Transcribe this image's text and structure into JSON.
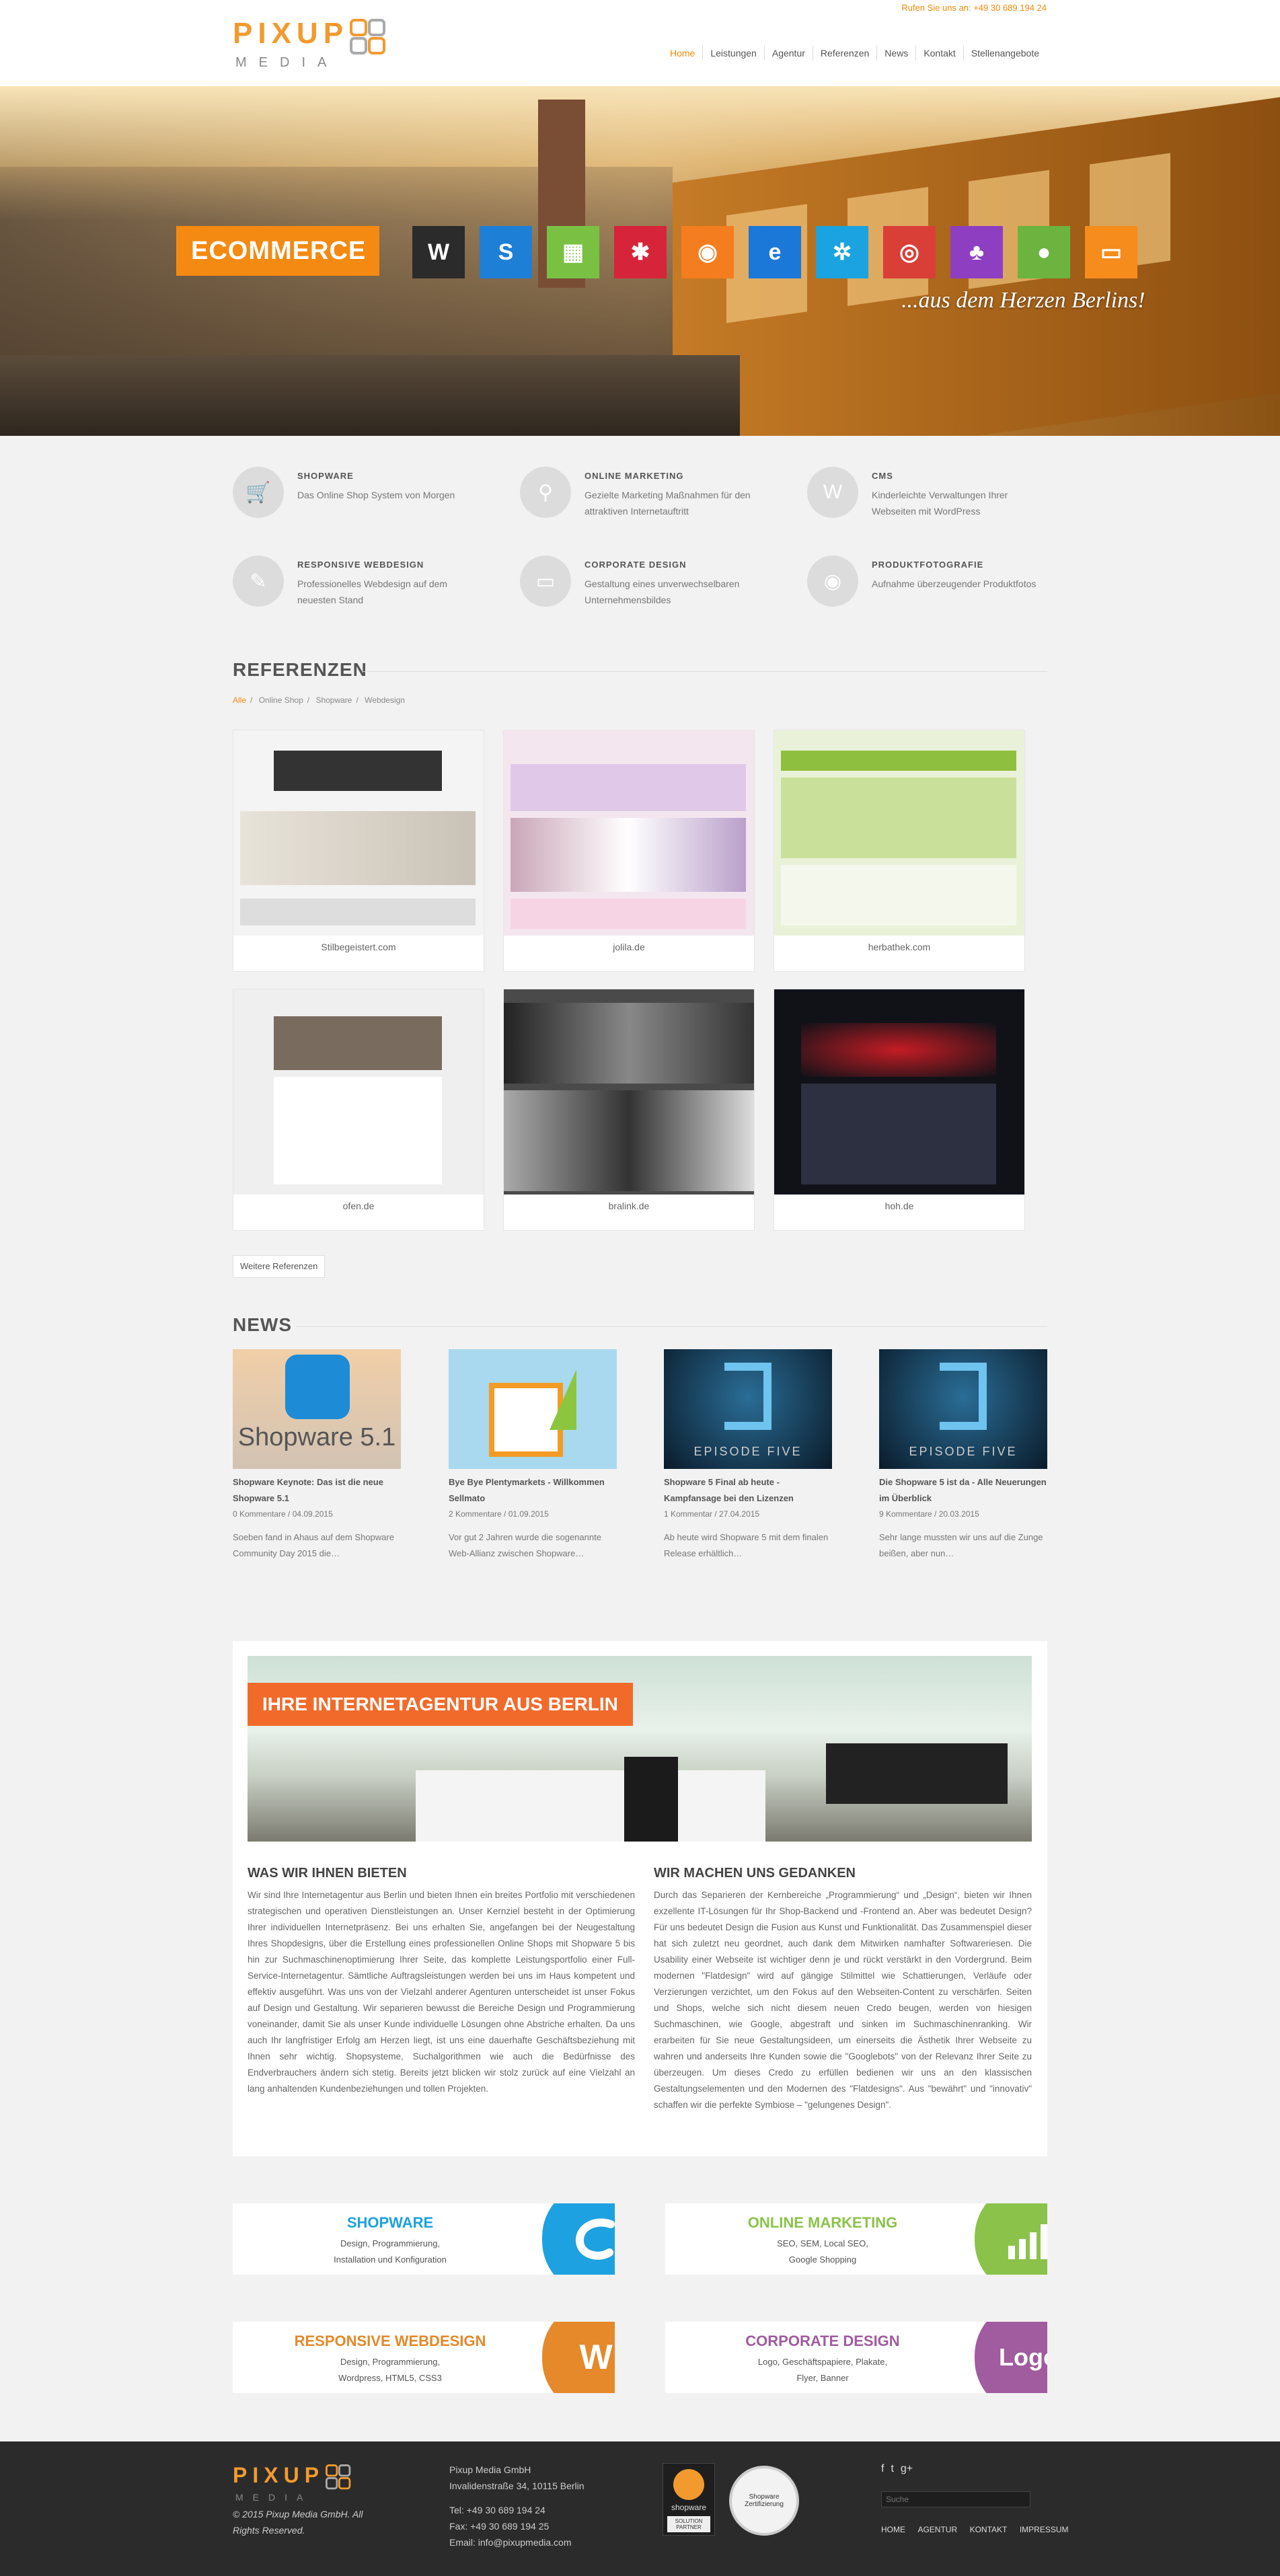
{
  "header": {
    "phone": "Rufen Sie uns an: +49 30 689 194 24",
    "logo_text": "PIXUP",
    "logo_sub": "MEDIA",
    "nav": [
      "Home",
      "Leistungen",
      "Agentur",
      "Referenzen",
      "News",
      "Kontakt",
      "Stellenangebote"
    ]
  },
  "hero": {
    "badge": "ECOMMERCE",
    "tiles": [
      {
        "icon": "wordpress-icon",
        "color": "#2b2b2b"
      },
      {
        "icon": "shopware-icon",
        "color": "#1e7fd6"
      },
      {
        "icon": "grid-icon",
        "color": "#7ac143"
      },
      {
        "icon": "joomla-icon",
        "color": "#d6243a"
      },
      {
        "icon": "firefox-icon",
        "color": "#f47d1f"
      },
      {
        "icon": "internet-explorer-icon",
        "color": "#1b78d8"
      },
      {
        "icon": "safari-icon",
        "color": "#1aa3e0"
      },
      {
        "icon": "chrome-icon",
        "color": "#d93f36"
      },
      {
        "icon": "android-icon",
        "color": "#8e3fc1"
      },
      {
        "icon": "apple-icon",
        "color": "#6cb33f"
      },
      {
        "icon": "message-icon",
        "color": "#f58c1c"
      }
    ],
    "slogan": "...aus dem Herzen Berlins!"
  },
  "services": [
    {
      "icon": "cart-icon",
      "title": "SHOPWARE",
      "desc": "Das Online Shop System von Morgen"
    },
    {
      "icon": "search-icon",
      "title": "ONLINE MARKETING",
      "desc": "Gezielte Marketing Maßnahmen für den attraktiven Internetauftritt"
    },
    {
      "icon": "wordpress-icon",
      "title": "CMS",
      "desc": "Kinderleichte Verwaltungen Ihrer Webseiten mit WordPress"
    },
    {
      "icon": "pencil-icon",
      "title": "RESPONSIVE WEBDESIGN",
      "desc": "Professionelles Webdesign auf dem neuesten Stand"
    },
    {
      "icon": "monitor-icon",
      "title": "CORPORATE DESIGN",
      "desc": "Gestaltung eines unverwechselbaren Unternehmensbildes"
    },
    {
      "icon": "camera-icon",
      "title": "PRODUKTFOTOGRAFIE",
      "desc": "Aufnahme überzeugender Produktfotos"
    }
  ],
  "references": {
    "title": "REFERENZEN",
    "filters": [
      "Alle",
      "Online Shop",
      "Shopware",
      "Webdesign"
    ],
    "items": [
      {
        "label": "Stilbegeistert.com",
        "bg": "#f4f4f4"
      },
      {
        "label": "jolila.de",
        "bg": "#f3e6ef"
      },
      {
        "label": "herbathek.com",
        "bg": "#e9f2d8"
      },
      {
        "label": "ofen.de",
        "bg": "#efefef"
      },
      {
        "label": "bralink.de",
        "bg": "#4a4a4a"
      },
      {
        "label": "hoh.de",
        "bg": "#101218"
      }
    ],
    "more_button": "Weitere Referenzen"
  },
  "news": {
    "title": "NEWS",
    "items": [
      {
        "title": "Shopware Keynote: Das ist die neue Shopware 5.1",
        "meta": "0 Kommentare / 04.09.2015",
        "excerpt": "Soeben fand in Ahaus auf dem Shopware Community Day 2015 die…",
        "image_text": "Shopware 5.1"
      },
      {
        "title": "Bye Bye Plentymarkets - Willkommen Sellmato",
        "meta": "2 Kommentare / 01.09.2015",
        "excerpt": "Vor gut 2 Jahren wurde die sogenannte Web-Allianz zwischen Shopware…",
        "image_text": ""
      },
      {
        "title": "Shopware 5 Final ab heute - Kampfansage bei den Lizenzen",
        "meta": "1 Kommentar / 27.04.2015",
        "excerpt": "Ab heute wird Shopware 5 mit dem finalen Release erhältlich…",
        "image_text": "EPISODE FIVE"
      },
      {
        "title": "Die Shopware 5 ist da - Alle Neuerungen im Überblick",
        "meta": "9 Kommentare / 20.03.2015",
        "excerpt": "Sehr lange mussten wir uns auf die Zunge beißen, aber nun…",
        "image_text": "EPISODE FIVE"
      }
    ]
  },
  "agency": {
    "banner": "IHRE INTERNETAGENTUR AUS BERLIN",
    "left_title": "WAS WIR IHNEN BIETEN",
    "left_text": "Wir sind Ihre Internetagentur aus Berlin und bieten Ihnen ein breites Portfolio mit verschiedenen strategischen und operativen Dienstleistungen an. Unser Kernziel besteht in der Optimierung Ihrer individuellen Internetpräsenz. Bei uns erhalten Sie, angefangen bei der Neugestaltung Ihres Shopdesigns, über die Erstellung eines professionellen Online Shops mit Shopware 5 bis hin zur Suchmaschinenoptimierung Ihrer Seite, das komplette Leistungsportfolio einer Full-Service-Internetagentur. Sämtliche Auftragsleistungen werden bei uns im Haus kompetent und effektiv ausgeführt. Was uns von der Vielzahl anderer Agenturen unterscheidet ist unser Fokus auf Design und Gestaltung. Wir separieren bewusst die Bereiche Design und Programmierung voneinander, damit Sie als unser Kunde individuelle Lösungen ohne Abstriche erhalten. Da uns auch Ihr langfristiger Erfolg am Herzen liegt, ist uns eine dauerhafte Geschäftsbeziehung mit Ihnen sehr wichtig. Shopsysteme, Suchalgorithmen wie auch die Bedürfnisse des Endverbrauchers ändern sich stetig. Bereits jetzt blicken wir stolz zurück auf eine Vielzahl an lang anhaltenden Kundenbeziehungen und tollen Projekten.",
    "right_title": "WIR MACHEN UNS GEDANKEN",
    "right_text": "Durch das Separieren der Kernbereiche „Programmierung“ und „Design“, bieten wir Ihnen exzellente IT-Lösungen für Ihr Shop-Backend und -Frontend an. Aber was bedeutet Design? Für uns bedeutet Design die Fusion aus Kunst und Funktionalität. Das Zusammenspiel dieser hat sich zuletzt neu geordnet, auch dank dem Mitwirken namhafter Softwareriesen. Die Usability einer Webseite ist wichtiger denn je und rückt verstärkt in den Vordergrund. Beim modernen \"Flatdesign\" wird auf gängige Stilmittel wie Schattierungen, Verläufe oder Verzierungen verzichtet, um den Fokus auf den Webseiten-Content zu verschärfen. Seiten und Shops, welche sich nicht diesem neuen Credo beugen, werden von hiesigen Suchmaschinen, wie Google, abgestraft und sinken im Suchmaschinenranking. Wir erarbeiten für Sie neue Gestaltungsideen, um einerseits die Ästhetik Ihrer Webseite zu wahren und anderseits Ihre Kunden sowie die \"Googlebots\" von der Relevanz Ihrer Seite zu überzeugen. Um dieses Credo zu erfüllen bedienen wir uns an den klassischen Gestaltungselementen und den Modernen des \"Flatdesigns\". Aus \"bewährt\" und \"innovativ\" schaffen wir die perfekte Symbiose – \"gelungenes Design\"."
  },
  "products": [
    {
      "title": "SHOPWARE",
      "lines": [
        "Design, Programmierung,",
        "Installation und Konfiguration"
      ],
      "color": "#1da1e0",
      "icon": "shopware-icon"
    },
    {
      "title": "ONLINE MARKETING",
      "lines": [
        "SEO, SEM, Local SEO,",
        "Google Shopping"
      ],
      "color": "#8bc34a",
      "icon": "chart-icon"
    },
    {
      "title": "RESPONSIVE WEBDESIGN",
      "lines": [
        "Design, Programmierung,",
        "Wordpress, HTML5, CSS3"
      ],
      "color": "#e5892a",
      "icon": "wordpress-icon"
    },
    {
      "title": "CORPORATE DESIGN",
      "lines": [
        "Logo, Geschäftspapiere, Plakate,",
        "Flyer, Banner"
      ],
      "color": "#a05c9e",
      "icon": "logo-icon"
    }
  ],
  "footer": {
    "logo_text": "PIXUP",
    "logo_sub": "MEDIA",
    "copyright": "© 2015 Pixup Media GmbH. All Rights Reserved.",
    "company": "Pixup Media GmbH",
    "address": "Invalidenstraße 34, 10115 Berlin",
    "tel": "Tel: +49 30 689 194 24",
    "fax": "Fax: +49 30 689 194 25",
    "email": "Email: info@pixupmedia.com",
    "partner_label": "shopware",
    "partner_badge": "SOLUTION PARTNER",
    "seal_text": "Shopware Zertifizierung",
    "social": [
      "f",
      "t",
      "g+"
    ],
    "search_placeholder": "Suche",
    "nav": [
      "HOME",
      "AGENTUR",
      "KONTAKT",
      "IMPRESSUM"
    ]
  }
}
